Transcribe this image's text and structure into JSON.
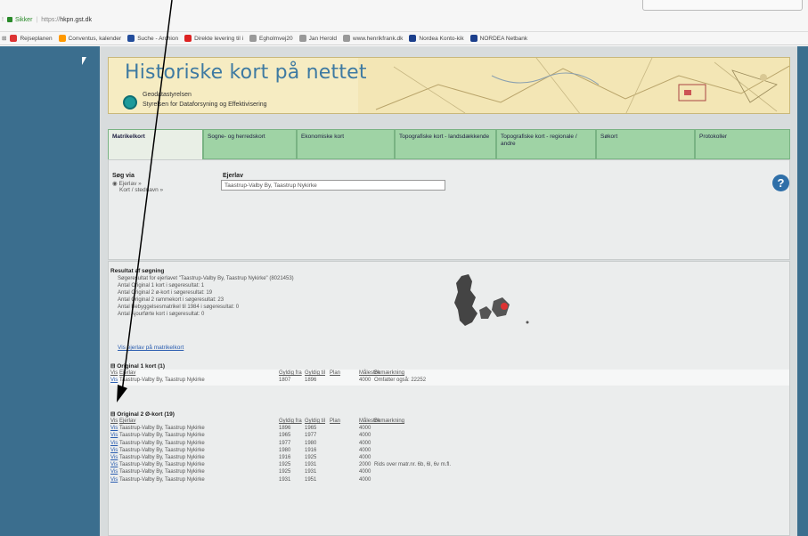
{
  "browser": {
    "secure_label": "Sikker",
    "url_proto": "https://",
    "url_host": "hkpn.gst.dk",
    "bookmarks": [
      {
        "label": "Rejseplanen",
        "color": "#d33"
      },
      {
        "label": "Conventus, kalender",
        "color": "#f90"
      },
      {
        "label": "Suche - Archion",
        "color": "#234d9c"
      },
      {
        "label": "Direkte levering til i",
        "color": "#d22"
      },
      {
        "label": "Egholmvej20",
        "color": "#999"
      },
      {
        "label": "Jan Herold",
        "color": "#999"
      },
      {
        "label": "www.henrikfrank.dk",
        "color": "#999"
      },
      {
        "label": "Nordea Konto-kik",
        "color": "#1c3f8c"
      },
      {
        "label": "NORDEA Netbank",
        "color": "#1c3f8c"
      }
    ]
  },
  "banner": {
    "title": "Historiske kort på nettet",
    "sub1": "Geodatastyrelsen",
    "sub2": "Styrelsen for Dataforsyning og Effektivisering"
  },
  "tabs": [
    {
      "label": "Matrikelkort"
    },
    {
      "label": "Sogne- og herredskort"
    },
    {
      "label": "Ekonomiske kort"
    },
    {
      "label": "Topografiske kort - landsdækkende"
    },
    {
      "label": "Topografiske kort - regionale / andre"
    },
    {
      "label": "Søkort"
    },
    {
      "label": "Protokoller"
    }
  ],
  "search": {
    "heading": "Søg via",
    "option1": "◉ Ejerlav »",
    "option2": "Kort / stednavn »",
    "ejerlav_label": "Ejerlav",
    "ejerlav_value": "Taastrup-Valby By, Taastrup Nykirke"
  },
  "result": {
    "heading": "Resultat af søgning",
    "lines": [
      "Søgeresultat for ejerlavet \"Taastrup-Valby By, Taastrup Nykirke\" (8021453)",
      "Antal Original 1 kort i søgeresultat: 1",
      "Antal Original 2 ø-kort i søgeresultat: 19",
      "Antal Original 2 rammekort i søgeresultat: 23",
      "Antal Bebyggelsesmatrikel til 1984 i søgeresultat: 0",
      "Antal Ajourførte kort i søgeresultat: 0"
    ],
    "link": "Vis ejerlav på matrikelkort"
  },
  "section1": {
    "title": "⊟ Original 1 kort (1)",
    "headers": [
      "Vis",
      "Ejerlav",
      "Gyldig fra",
      "Gyldig til",
      "Plan",
      "Målestok",
      "Bemærkning"
    ],
    "rows": [
      [
        "Vis",
        "Taastrup-Valby By, Taastrup Nykirke",
        "1807",
        "1896",
        "",
        "4000",
        "Omfatter også: 22252"
      ]
    ]
  },
  "section2": {
    "title": "⊟ Original 2 Ø-kort (19)",
    "headers": [
      "Vis",
      "Ejerlav",
      "Gyldig fra",
      "Gyldig til",
      "Plan",
      "Målestok",
      "Bemærkning"
    ],
    "rows": [
      [
        "Vis",
        "Taastrup-Valby By, Taastrup Nykirke",
        "1896",
        "1965",
        "",
        "4000",
        ""
      ],
      [
        "Vis",
        "Taastrup-Valby By, Taastrup Nykirke",
        "1965",
        "1977",
        "",
        "4000",
        ""
      ],
      [
        "Vis",
        "Taastrup-Valby By, Taastrup Nykirke",
        "1977",
        "1980",
        "",
        "4000",
        ""
      ],
      [
        "Vis",
        "Taastrup-Valby By, Taastrup Nykirke",
        "1980",
        "1916",
        "",
        "4000",
        ""
      ],
      [
        "Vis",
        "Taastrup-Valby By, Taastrup Nykirke",
        "1916",
        "1925",
        "",
        "4000",
        ""
      ],
      [
        "Vis",
        "Taastrup-Valby By, Taastrup Nykirke",
        "1925",
        "1931",
        "",
        "2000",
        "Rids over matr.nr. 6b, 6l, 6v m.fl."
      ],
      [
        "Vis",
        "Taastrup-Valby By, Taastrup Nykirke",
        "1925",
        "1931",
        "",
        "4000",
        ""
      ],
      [
        "Vis",
        "Taastrup-Valby By, Taastrup Nykirke",
        "1931",
        "1951",
        "",
        "4000",
        ""
      ]
    ]
  }
}
